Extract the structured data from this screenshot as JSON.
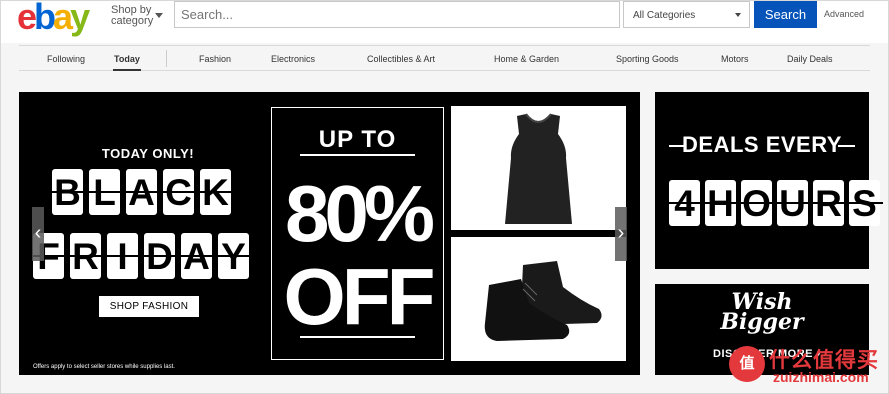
{
  "header": {
    "logo": [
      "e",
      "b",
      "a",
      "y"
    ],
    "logo_colors": [
      "#e53238",
      "#0064d2",
      "#f5af02",
      "#86b817"
    ],
    "shop_by_line1": "Shop by",
    "shop_by_line2": "category",
    "search_placeholder": "Search...",
    "category_select": "All Categories",
    "search_button": "Search",
    "advanced_link": "Advanced"
  },
  "nav": {
    "items": [
      "Following",
      "Today",
      "Fashion",
      "Electronics",
      "Collectibles & Art",
      "Home & Garden",
      "Sporting Goods",
      "Motors",
      "Daily Deals"
    ],
    "active": "Today"
  },
  "hero": {
    "today_only": "TODAY ONLY!",
    "word1": [
      "B",
      "L",
      "A",
      "C",
      "K"
    ],
    "word2": [
      "F",
      "R",
      "I",
      "D",
      "A",
      "Y"
    ],
    "shop_button": "SHOP FASHION",
    "fine_print": "Offers apply to select seller stores while supplies last.",
    "promo_up_to": "UP TO",
    "promo_percent": "80%",
    "promo_off": "OFF",
    "prev_arrow": "‹",
    "next_arrow": "›"
  },
  "deals_banner": {
    "headline": "DEALS EVERY",
    "hours": [
      "4",
      "H",
      "O",
      "U",
      "R",
      "S"
    ]
  },
  "wish_banner": {
    "line1": "Wish",
    "line2": "Bigger",
    "cta": "DISCOVER MORE ›"
  },
  "watermark": {
    "badge": "值",
    "text": "什么值得买",
    "url": "zuizhimai.com"
  }
}
